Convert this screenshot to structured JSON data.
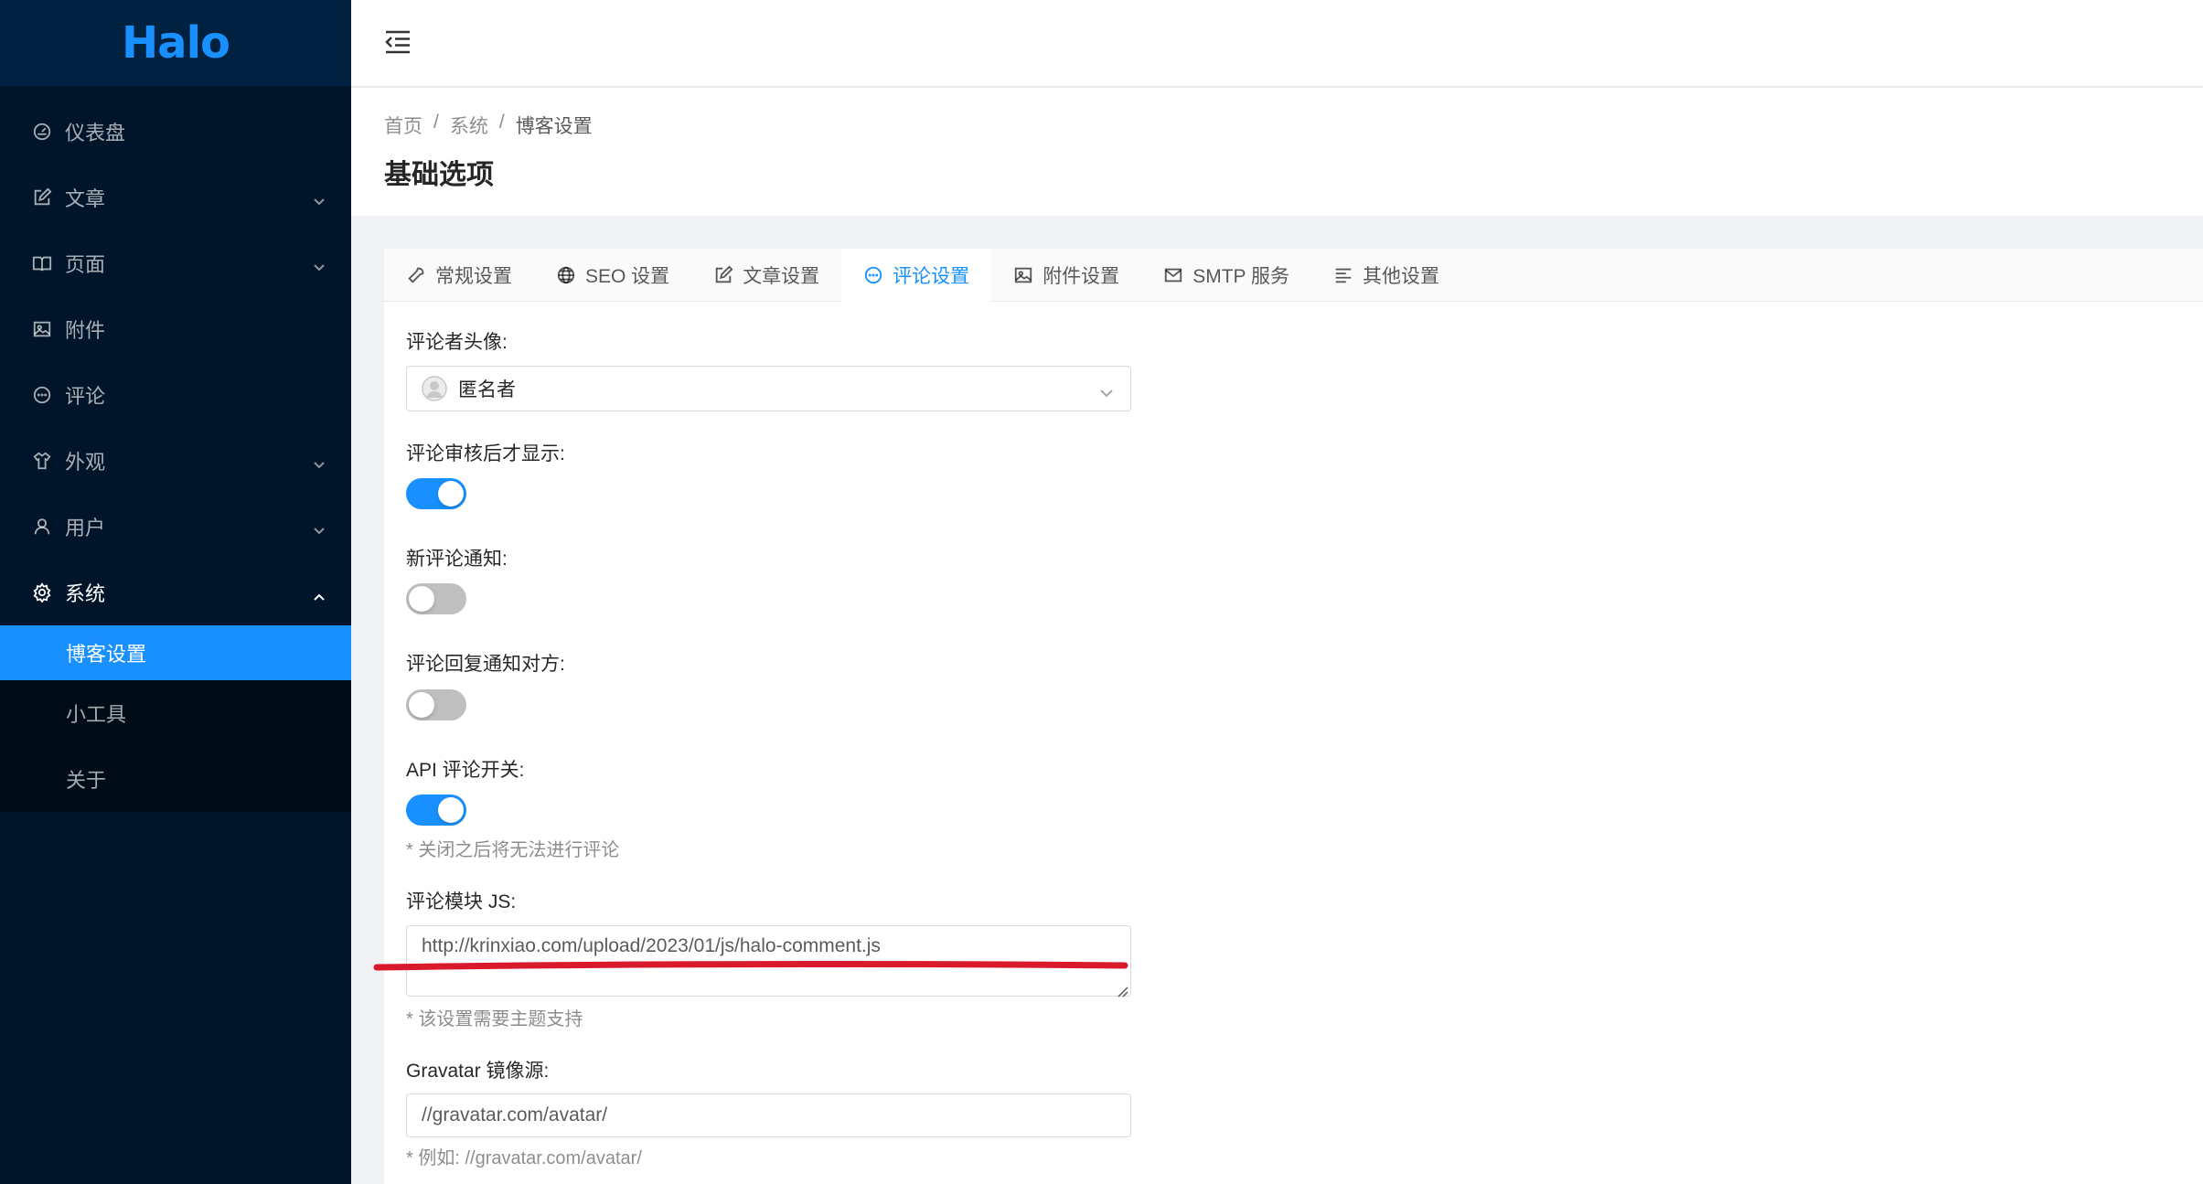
{
  "app": {
    "logo": "Halo"
  },
  "sidebar": {
    "items": [
      {
        "label": "仪表盘",
        "icon": "dashboard-icon",
        "has_arrow": false
      },
      {
        "label": "文章",
        "icon": "edit-icon",
        "has_arrow": true
      },
      {
        "label": "页面",
        "icon": "read-icon",
        "has_arrow": true
      },
      {
        "label": "附件",
        "icon": "picture-icon",
        "has_arrow": false
      },
      {
        "label": "评论",
        "icon": "message-icon",
        "has_arrow": false
      },
      {
        "label": "外观",
        "icon": "skin-icon",
        "has_arrow": true
      },
      {
        "label": "用户",
        "icon": "user-icon",
        "has_arrow": true
      },
      {
        "label": "系统",
        "icon": "setting-icon",
        "has_arrow": true,
        "open": true
      }
    ],
    "submenu": [
      {
        "label": "博客设置",
        "active": true
      },
      {
        "label": "小工具",
        "active": false
      },
      {
        "label": "关于",
        "active": false
      }
    ]
  },
  "breadcrumb": {
    "home": "首页",
    "section": "系统",
    "current": "博客设置",
    "separator": "/"
  },
  "page": {
    "title": "基础选项"
  },
  "tabs": [
    {
      "label": "常规设置",
      "icon": "tool-icon",
      "active": false
    },
    {
      "label": "SEO 设置",
      "icon": "global-icon",
      "active": false
    },
    {
      "label": "文章设置",
      "icon": "form-icon",
      "active": false
    },
    {
      "label": "评论设置",
      "icon": "message-icon",
      "active": true
    },
    {
      "label": "附件设置",
      "icon": "picture-icon",
      "active": false
    },
    {
      "label": "SMTP 服务",
      "icon": "mail-icon",
      "active": false
    },
    {
      "label": "其他设置",
      "icon": "align-left-icon",
      "active": false
    }
  ],
  "form": {
    "avatar_label": "评论者头像:",
    "avatar_value": "匿名者",
    "review_label": "评论审核后才显示:",
    "review_on": true,
    "notify_label": "新评论通知:",
    "notify_on": false,
    "reply_notify_label": "评论回复通知对方:",
    "reply_notify_on": false,
    "api_label": "API 评论开关:",
    "api_on": true,
    "api_help": "* 关闭之后将无法进行评论",
    "js_label": "评论模块 JS:",
    "js_value": "http://krinxiao.com/upload/2023/01/js/halo-comment.js",
    "js_help": "* 该设置需要主题支持",
    "gravatar_label": "Gravatar 镜像源:",
    "gravatar_value": "//gravatar.com/avatar/",
    "gravatar_help": "* 例如:  //gravatar.com/avatar/"
  },
  "colors": {
    "primary": "#1890ff",
    "sidebar": "#001529",
    "annotation": "#d9192c"
  }
}
